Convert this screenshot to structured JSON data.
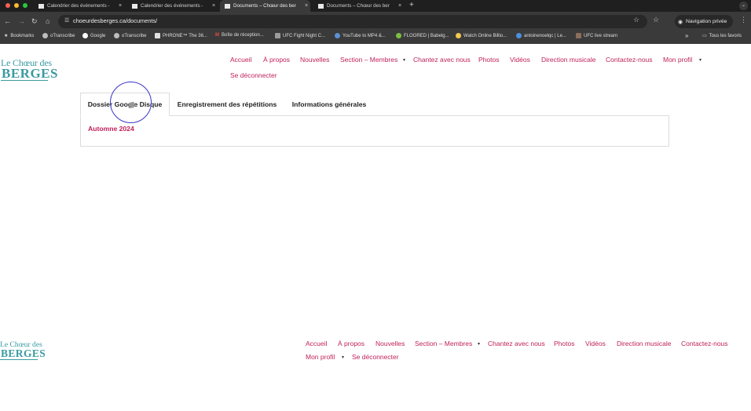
{
  "browser": {
    "tabs": [
      {
        "title": "Calendrier des événements -",
        "active": false
      },
      {
        "title": "Calendrier des événements -",
        "active": false
      },
      {
        "title": "Documents – Chœur des ber",
        "active": true
      },
      {
        "title": "Documents – Chœur des ber",
        "active": false
      }
    ],
    "tab_close": "×",
    "new_tab": "+",
    "tab_menu": "⌄",
    "url": "choeurdesberges.ca/documents/",
    "private_label": "Navigation privée",
    "bookmarks": [
      {
        "label": "Bookmarks",
        "icon": "star-icon"
      },
      {
        "label": "oTranscribe",
        "icon": "globe-icon"
      },
      {
        "label": "Google",
        "icon": "google-icon"
      },
      {
        "label": "oTranscribe",
        "icon": "globe-icon"
      },
      {
        "label": "PHRONE™ The 36...",
        "icon": "site-icon"
      },
      {
        "label": "Boîte de réception...",
        "icon": "gmail-icon"
      },
      {
        "label": "UFC Fight Night C...",
        "icon": "site-icon"
      },
      {
        "label": "YouTube to MP4 &...",
        "icon": "site-icon"
      },
      {
        "label": "FLOORED | Babelg...",
        "icon": "site-icon"
      },
      {
        "label": "Watch Online Billio...",
        "icon": "site-icon"
      },
      {
        "label": "antoinenoelqc | Le...",
        "icon": "site-icon"
      },
      {
        "label": "UFC live stream",
        "icon": "site-icon"
      }
    ],
    "bookmarks_overflow": "»",
    "all_bookmarks": "Tous les favoris"
  },
  "site": {
    "logo_line1": "Le Chœur des",
    "logo_line2": "BERGES",
    "nav": [
      "Accueil",
      "À propos",
      "Nouvelles",
      "Section – Membres",
      "Chantez avec nous",
      "Photos",
      "Vidéos",
      "Direction musicale",
      "Contactez-nous",
      "Mon profil",
      "Se déconnecter"
    ],
    "caret": "▾"
  },
  "content": {
    "tabs": [
      "Dossier Google Disque",
      "Enregistrement des répétitions",
      "Informations générales"
    ],
    "active_tab": 0,
    "section_title": "Automne 2024"
  },
  "colors": {
    "accent": "#c0215a",
    "brand_teal": "#3a9aa1",
    "chrome_dark": "#1f1f1f",
    "chrome_toolbar": "#3a3a3a"
  }
}
